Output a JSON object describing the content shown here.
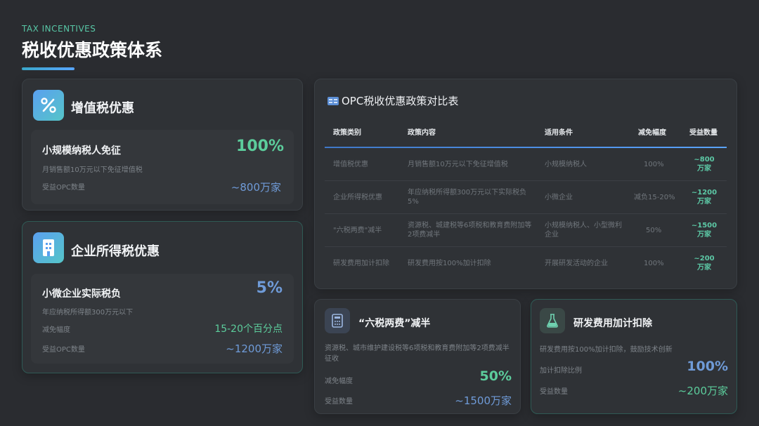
{
  "header": {
    "subtitle": "TAX INCENTIVES",
    "title": "税收优惠政策体系"
  },
  "vat_card": {
    "title": "增值税优惠",
    "icon": "percent-icon",
    "main_label": "小规模纳税人免征",
    "main_value": "100%",
    "desc": "月销售额10万元以下免征增值税",
    "beneficiary_label": "受益OPC数量",
    "beneficiary_value": "~800万家"
  },
  "income_card": {
    "title": "企业所得税优惠",
    "icon": "building-icon",
    "main_label": "小微企业实际税负",
    "main_value": "5%",
    "desc": "年应纳税所得额300万元以下",
    "reduction_label": "减免幅度",
    "reduction_value": "15-20个百分点",
    "beneficiary_label": "受益OPC数量",
    "beneficiary_value": "~1200万家"
  },
  "table": {
    "title": "OPC税收优惠政策对比表",
    "icon": "table-icon",
    "headers": [
      "政策类别",
      "政策内容",
      "适用条件",
      "减免幅度",
      "受益数量"
    ],
    "rows": [
      [
        "增值税优惠",
        "月销售额10万元以下免征增值税",
        "小规模纳税人",
        "100%",
        "~800万家"
      ],
      [
        "企业所得税优惠",
        "年应纳税所得额300万元以下实际税负5%",
        "小微企业",
        "减负15-20%",
        "~1200万家"
      ],
      [
        "\"六税两费\"减半",
        "资源税、城建税等6项税和教育费附加等2项费减半",
        "小规模纳税人、小型微利企业",
        "50%",
        "~1500万家"
      ],
      [
        "研发费用加计扣除",
        "研发费用按100%加计扣除",
        "开展研发活动的企业",
        "100%",
        "~200万家"
      ]
    ]
  },
  "six_card": {
    "title": "“六税两费”减半",
    "icon": "calculator-icon",
    "desc": "资源税、城市维护建设税等6项税和教育费附加等2项费减半征收",
    "reduction_label": "减免幅度",
    "reduction_value": "50%",
    "beneficiary_label": "受益数量",
    "beneficiary_value": "~1500万家"
  },
  "rd_card": {
    "title": "研发费用加计扣除",
    "icon": "flask-icon",
    "desc": "研发费用按100%加计扣除，鼓励技术创新",
    "ratio_label": "加计扣除比例",
    "ratio_value": "100%",
    "beneficiary_label": "受益数量",
    "beneficiary_value": "~200万家"
  }
}
